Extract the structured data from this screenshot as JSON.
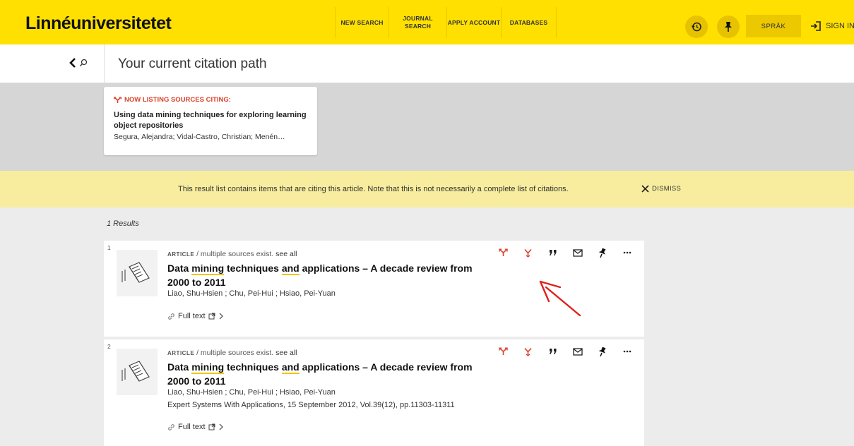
{
  "header": {
    "logo": "Linnéuniversitetet",
    "nav": [
      {
        "label": "NEW SEARCH"
      },
      {
        "label": "JOURNAL SEARCH"
      },
      {
        "label": "APPLY ACCOUNT"
      },
      {
        "label": "DATABASES"
      }
    ],
    "language_label": "SPRÅK",
    "signin_label": "SIGN IN",
    "brand_color": "#ffe000"
  },
  "citation_path": {
    "title": "Your current citation path"
  },
  "citing_card": {
    "label": "NOW LISTING SOURCES CITING:",
    "title": "Using data mining techniques for exploring learning object repositories",
    "authors": "Segura, Alejandra; Vidal-Castro, Christian; Menén…"
  },
  "notice": {
    "message": "This result list contains items that are citing this article. Note that this is not necessarily a complete list of citations.",
    "dismiss_label": "DISMISS"
  },
  "results_count": "1 Results",
  "results": [
    {
      "number": "1",
      "type": "ARTICLE",
      "sources_note": "/ multiple sources exist.",
      "see_all": "see all",
      "title_pre": "Data ",
      "title_hl1": "mining",
      "title_mid": " techniques ",
      "title_hl2": "and",
      "title_post": " applications – A decade review from 2000 to 2011",
      "authors": "Liao, Shu-Hsien ; Chu, Pei-Hui ; Hsiao, Pei-Yuan",
      "source": "",
      "full_text": "Full text"
    },
    {
      "number": "2",
      "type": "ARTICLE",
      "sources_note": "/ multiple sources exist.",
      "see_all": "see all",
      "title_pre": "Data ",
      "title_hl1": "mining",
      "title_mid": " techniques ",
      "title_hl2": "and",
      "title_post": " applications – A decade review from 2000 to 2011",
      "authors": "Liao, Shu-Hsien ; Chu, Pei-Hui ; Hsiao, Pei-Yuan",
      "source": "Expert Systems With Applications, 15 September 2012, Vol.39(12), pp.11303-11311",
      "full_text": "Full text"
    }
  ],
  "icons": {
    "back": "chevron-left-icon",
    "search": "search-icon",
    "history": "history-icon",
    "pin": "pin-icon",
    "signin": "sign-in-icon",
    "citing": "citing-icon",
    "cited": "cited-by-icon",
    "quote": "quote-icon",
    "email": "email-icon",
    "more": "more-icon"
  },
  "colors": {
    "accent_red": "#d9422b",
    "highlight": "#f0c400",
    "notice_bg": "#f8ed9e"
  }
}
